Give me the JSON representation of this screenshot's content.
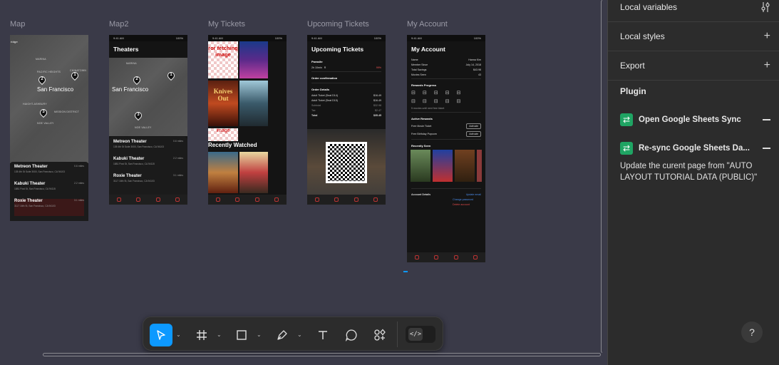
{
  "canvas": {
    "frames": [
      {
        "label": "Map"
      },
      {
        "label": "Map2"
      },
      {
        "label": "My Tickets"
      },
      {
        "label": "Upcoming Tickets"
      },
      {
        "label": "My Account"
      }
    ],
    "map": {
      "city": "San Francisco",
      "districts": [
        "MARINA",
        "PACIFIC HEIGHTS",
        "CHINATOWN",
        "HAIGHT-ASHBURY",
        "MISSION DISTRICT",
        "NOE VALLEY"
      ],
      "pins": [
        "1",
        "2",
        "3"
      ],
      "corner_text": "ridge"
    },
    "map2": {
      "title": "Theaters"
    },
    "theaters": [
      {
        "name": "Metreon Theater",
        "address": "135 4th St Suite 3000, San Francisco, CA 94103",
        "distance": "0.6 miles"
      },
      {
        "name": "Kabuki Theater",
        "address": "1881 Post St, San Francisco, CA 94115",
        "distance": "2.2 miles"
      },
      {
        "name": "Roxie Theater",
        "address": "3117 16th St, San Francisco, CA 94103",
        "distance": "3.1 miles"
      }
    ],
    "my_tickets": {
      "error_text": "ror fetching image",
      "image_text": "image",
      "recently_watched": "Recently Watched",
      "knives_out": "Knives Out"
    },
    "upcoming": {
      "title": "Upcoming Tickets",
      "movie": "Parasite",
      "runtime": "2h 10min",
      "rating": "R",
      "score": "99%",
      "confirmation": "Order confirmation",
      "details_title": "Order Details",
      "lines": [
        {
          "k": "Adult Ticket (Seat D14)",
          "v": "$16.49"
        },
        {
          "k": "Adult Ticket (Seat D15)",
          "v": "$16.49"
        },
        {
          "k": "Subtotal",
          "v": "$32.98"
        },
        {
          "k": "Tax",
          "v": "$2.47"
        },
        {
          "k": "Total",
          "v": "$35.45"
        }
      ]
    },
    "account": {
      "title": "My Account",
      "rows": [
        {
          "k": "Name",
          "v": "Hanna Kim"
        },
        {
          "k": "Member Since",
          "v": "July 14, 2018"
        },
        {
          "k": "Total Savings",
          "v": "$43.98"
        },
        {
          "k": "Movies Seen",
          "v": "43"
        }
      ],
      "rewards_title": "Rewards Progress",
      "rewards_note": "5 movies until next free ticket",
      "active_title": "Active Rewards",
      "active": [
        {
          "label": "Free Movie Ticket",
          "button": "Activate"
        },
        {
          "label": "Free Birthday Popcorn",
          "button": "Activate"
        }
      ],
      "recent_title": "Recently Seen",
      "details_title": "Account Details",
      "links": [
        "Update email",
        "Change password",
        "Delete account"
      ]
    },
    "status_time": "9:41 AM",
    "status_battery": "100%"
  },
  "panel": {
    "local_variables": "Local variables",
    "local_styles": "Local styles",
    "export": "Export",
    "plugin": "Plugin",
    "plugins": [
      {
        "label": "Open Google Sheets Sync"
      },
      {
        "label": "Re-sync Google Sheets Da..."
      }
    ],
    "description": "Update the curent page from \"AUTO LAYOUT TUTORIAL DATA (PUBLIC)\""
  },
  "toolbar": {
    "tools": [
      "move-tool",
      "frame-tool",
      "shape-tool",
      "pen-tool",
      "text-tool",
      "comment-tool",
      "actions-tool"
    ],
    "dev_mode": "</>"
  },
  "help": "?",
  "colors": {
    "accent": "#0d99ff",
    "plugin_green": "#1fa463",
    "canvas": "#3a3a48",
    "panel": "#2c2c2c"
  }
}
